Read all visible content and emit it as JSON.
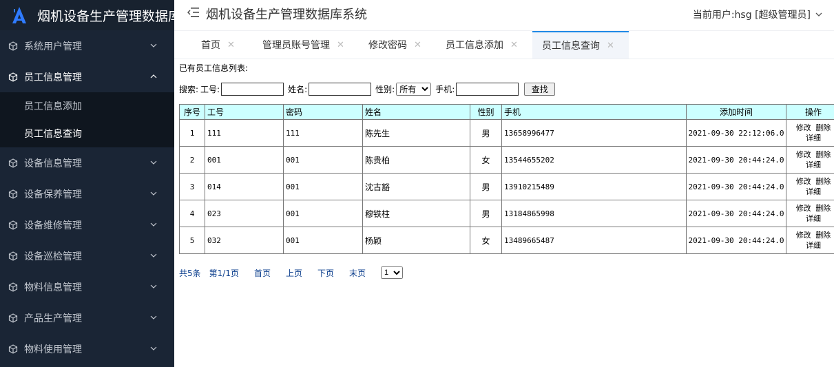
{
  "app": {
    "title": "烟机设备生产管理数据库系统",
    "logo_text": "烟机设备生产管理数据库",
    "current_user": "当前用户:hsg [超级管理员]"
  },
  "colors": {
    "sidebar_bg": "#1a2535",
    "accent": "#1e88e5",
    "table_header_bg": "#ccffff"
  },
  "sidebar": {
    "items": [
      {
        "label": "系统用户管理"
      },
      {
        "label": "员工信息管理",
        "open": true,
        "children": [
          {
            "label": "员工信息添加"
          },
          {
            "label": "员工信息查询",
            "active": true
          }
        ]
      },
      {
        "label": "设备信息管理"
      },
      {
        "label": "设备保养管理"
      },
      {
        "label": "设备维修管理"
      },
      {
        "label": "设备巡检管理"
      },
      {
        "label": "物料信息管理"
      },
      {
        "label": "产品生产管理"
      },
      {
        "label": "物料使用管理"
      }
    ]
  },
  "tabs": [
    {
      "label": "首页"
    },
    {
      "label": "管理员账号管理"
    },
    {
      "label": "修改密码"
    },
    {
      "label": "员工信息添加"
    },
    {
      "label": "员工信息查询",
      "active": true
    }
  ],
  "content": {
    "list_title": "已有员工信息列表:",
    "search": {
      "label": "搜索:",
      "emp_no_label": "工号:",
      "emp_no_value": "",
      "name_label": "姓名:",
      "name_value": "",
      "gender_label": "性别:",
      "gender_value": "所有",
      "phone_label": "手机:",
      "phone_value": "",
      "button": "查找"
    },
    "table": {
      "headers": [
        "序号",
        "工号",
        "密码",
        "姓名",
        "性别",
        "手机",
        "添加时间",
        "操作"
      ],
      "rows": [
        {
          "no": "1",
          "emp_no": "111",
          "password": "111",
          "name": "陈先生",
          "gender": "男",
          "phone": "13658996477",
          "time": "2021-09-30 22:12:06.0"
        },
        {
          "no": "2",
          "emp_no": "001",
          "password": "001",
          "name": "陈贵柏",
          "gender": "女",
          "phone": "13544655202",
          "time": "2021-09-30 20:44:24.0"
        },
        {
          "no": "3",
          "emp_no": "014",
          "password": "001",
          "name": "沈古豁",
          "gender": "男",
          "phone": "13910215489",
          "time": "2021-09-30 20:44:24.0"
        },
        {
          "no": "4",
          "emp_no": "023",
          "password": "001",
          "name": "穆铁柱",
          "gender": "男",
          "phone": "13184865998",
          "time": "2021-09-30 20:44:24.0"
        },
        {
          "no": "5",
          "emp_no": "032",
          "password": "001",
          "name": "杨颖",
          "gender": "女",
          "phone": "13489665487",
          "time": "2021-09-30 20:44:24.0"
        }
      ],
      "actions": {
        "edit": "修改",
        "delete": "删除",
        "detail": "详细"
      }
    },
    "pager": {
      "total": "共5条",
      "page_info": "第1/1页",
      "first": "首页",
      "prev": "上页",
      "next": "下页",
      "last": "末页",
      "page_select": "1"
    }
  }
}
